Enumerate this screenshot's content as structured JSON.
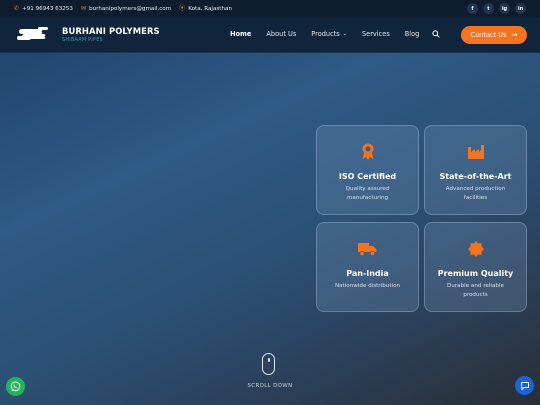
{
  "topbar": {
    "phone": "+91 96943 63253",
    "email": "burhanipolymers@gmail.com",
    "location": "Kota, Rajasthan",
    "social": [
      "f",
      "t",
      "ig",
      "in"
    ]
  },
  "brand": {
    "name": "BURHANI POLYMERS",
    "tagline": "SHIBAAM PIPES"
  },
  "nav": {
    "home": "Home",
    "about": "About Us",
    "products": "Products",
    "services": "Services",
    "blog": "Blog",
    "contact": "Contact Us"
  },
  "features": [
    {
      "title": "ISO Certified",
      "desc": "Quality assured manufacturing",
      "icon": "award-icon"
    },
    {
      "title": "State-of-the-Art",
      "desc": "Advanced production facilities",
      "icon": "industry-icon"
    },
    {
      "title": "Pan-India",
      "desc": "Nationwide distribution",
      "icon": "truck-icon"
    },
    {
      "title": "Premium Quality",
      "desc": "Durable and reliable products",
      "icon": "badge-icon"
    }
  ],
  "scroll": {
    "label": "SCROLL DOWN"
  },
  "colors": {
    "accent": "#f47420",
    "header": "#10243c",
    "whatsapp": "#25b25b",
    "chat": "#1a64d6"
  }
}
